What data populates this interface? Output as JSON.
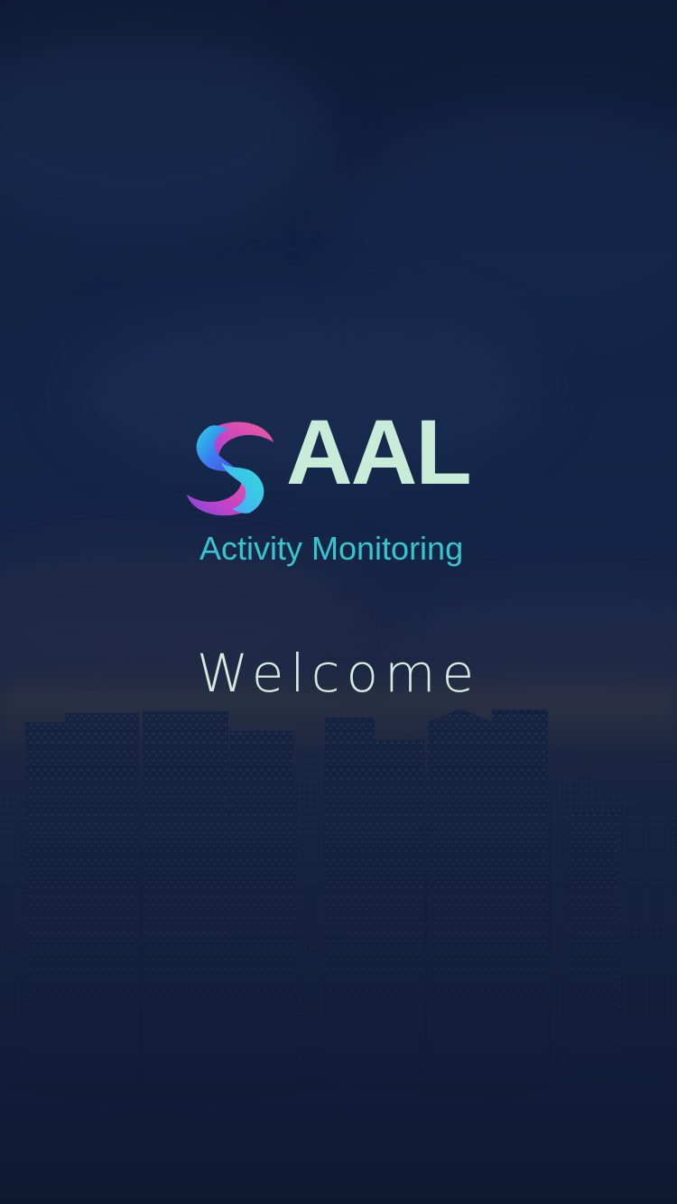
{
  "logo": {
    "title": "AAL",
    "subtitle": "Activity Monitoring",
    "icon": "swirl-logo-icon"
  },
  "welcome": {
    "text": "Welcome"
  },
  "colors": {
    "logo_title": "#c9ecd9",
    "logo_subtitle": "#36c6cf",
    "welcome_text": "#d3ecdf",
    "background": "#162a4d"
  }
}
